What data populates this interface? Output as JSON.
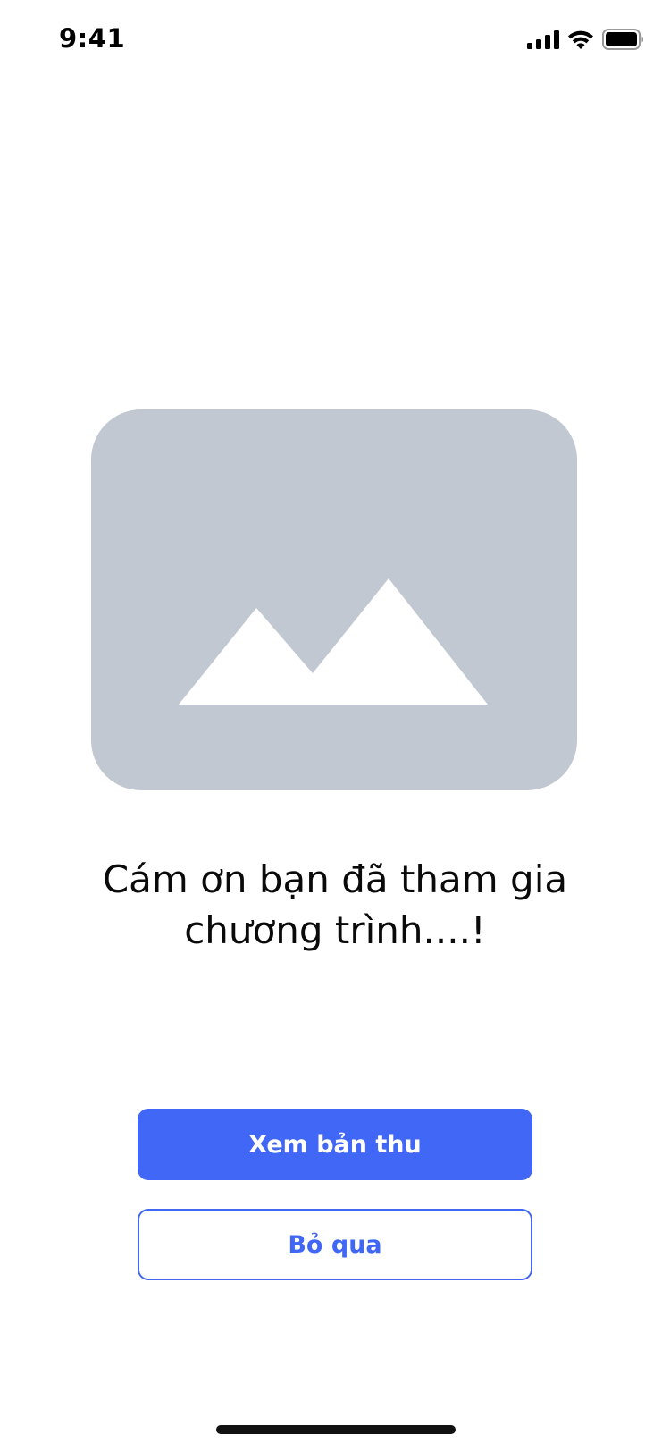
{
  "status_bar": {
    "time": "9:41",
    "icons": [
      "cellular-signal-icon",
      "wifi-icon",
      "battery-icon"
    ]
  },
  "illustration": {
    "icon": "image-placeholder-icon",
    "background_color": "#c2c8d1"
  },
  "message": {
    "line1": "Cám ơn bạn đã tham gia",
    "line2": "chương trình....!"
  },
  "actions": {
    "primary_label": "Xem bản thu",
    "secondary_label": "Bỏ qua",
    "accent_color": "#4167f6"
  }
}
